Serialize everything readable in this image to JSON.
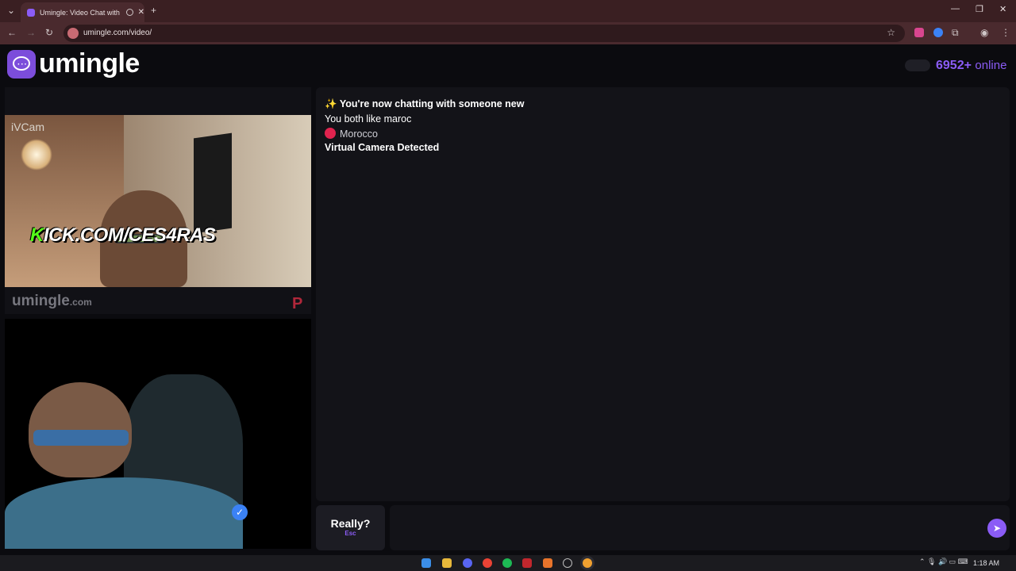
{
  "browser": {
    "tab_title": "Umingle: Video Chat with S",
    "url": "umingle.com/video/",
    "new_tab": "+",
    "close_tab": "✕"
  },
  "site": {
    "logo_text": "umingle",
    "online_count": "6952+",
    "online_word": "online",
    "accent": "#8b5cf6"
  },
  "stranger": {
    "cam_label": "iVCam",
    "watermark": "umingle",
    "watermark_suffix": ".com",
    "report_glyph": "P"
  },
  "chat": {
    "messages": [
      {
        "icon": "✨",
        "text": "You're now chatting with someone new"
      },
      {
        "text": "You both like maroc"
      },
      {
        "country": "Morocco"
      },
      {
        "text": "Virtual Camera Detected"
      }
    ]
  },
  "controls": {
    "skip_label": "Really?",
    "skip_hint": "Esc",
    "input_placeholder": "",
    "send_icon": "send-icon"
  },
  "overlay": {
    "kick_k": "K",
    "kick_rest": "ICK.COM/CES4RAS"
  },
  "taskbar": {
    "time": "1:18 AM"
  }
}
